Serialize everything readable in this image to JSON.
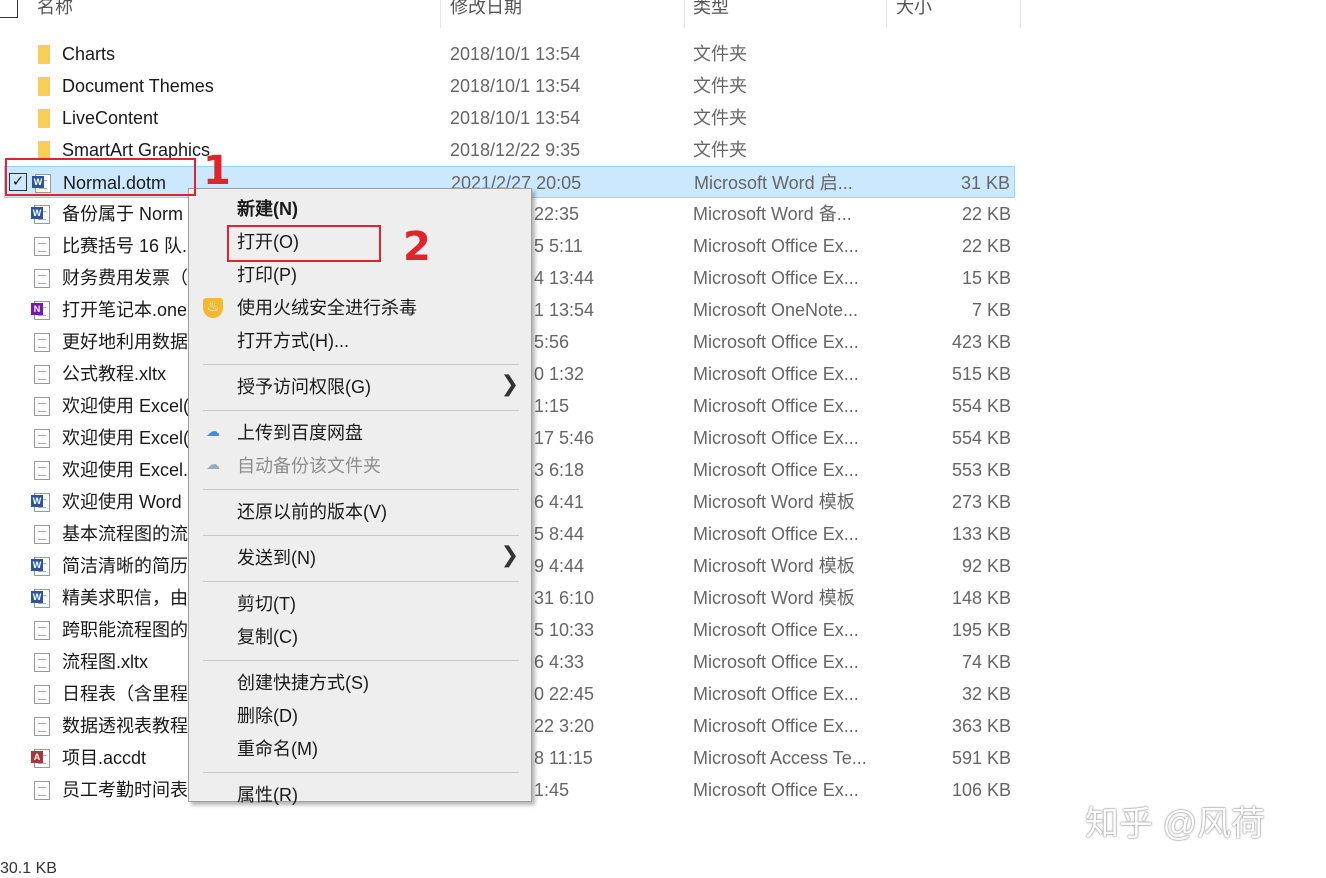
{
  "header": {
    "name": "名称",
    "date": "修改日期",
    "type": "类型",
    "size": "大小"
  },
  "files": [
    {
      "name": "Charts",
      "date": "2018/10/1 13:54",
      "type": "文件夹",
      "size": "",
      "icon": "folder-icon"
    },
    {
      "name": "Document Themes",
      "date": "2018/10/1 13:54",
      "type": "文件夹",
      "size": "",
      "icon": "folder-icon"
    },
    {
      "name": "LiveContent",
      "date": "2018/10/1 13:54",
      "type": "文件夹",
      "size": "",
      "icon": "folder-icon"
    },
    {
      "name": "SmartArt Graphics",
      "date": "2018/12/22 9:35",
      "type": "文件夹",
      "size": "",
      "icon": "folder-icon"
    },
    {
      "name": "Normal.dotm",
      "date": "2021/2/27 20:05",
      "type": "Microsoft Word 启...",
      "size": "31 KB",
      "icon": "word-icon",
      "selected": true
    },
    {
      "name": "备份属于 Norm",
      "date_partial": "22:35",
      "type": "Microsoft Word 备...",
      "size": "22 KB",
      "icon": "word-icon"
    },
    {
      "name": "比赛括号 16 队.",
      "date_partial": "5 5:11",
      "type": "Microsoft Office Ex...",
      "size": "22 KB",
      "icon": "document-icon"
    },
    {
      "name": "财务费用发票（",
      "date_partial": "4 13:44",
      "type": "Microsoft Office Ex...",
      "size": "15 KB",
      "icon": "document-icon"
    },
    {
      "name": "打开笔记本.one",
      "date_partial": "1 13:54",
      "type": "Microsoft OneNote...",
      "size": "7 KB",
      "icon": "onenote-icon"
    },
    {
      "name": "更好地利用数据",
      "date_partial": "5:56",
      "type": "Microsoft Office Ex...",
      "size": "423 KB",
      "icon": "document-icon"
    },
    {
      "name": "公式教程.xltx",
      "date_partial": "0 1:32",
      "type": "Microsoft Office Ex...",
      "size": "515 KB",
      "icon": "document-icon"
    },
    {
      "name": "欢迎使用 Excel(",
      "date_partial": "1:15",
      "type": "Microsoft Office Ex...",
      "size": "554 KB",
      "icon": "document-icon"
    },
    {
      "name": "欢迎使用 Excel(",
      "date_partial": "17 5:46",
      "type": "Microsoft Office Ex...",
      "size": "554 KB",
      "icon": "document-icon"
    },
    {
      "name": "欢迎使用 Excel.",
      "date_partial": "3 6:18",
      "type": "Microsoft Office Ex...",
      "size": "553 KB",
      "icon": "document-icon"
    },
    {
      "name": "欢迎使用 Word",
      "date_partial": "6 4:41",
      "type": "Microsoft Word 模板",
      "size": "273 KB",
      "icon": "word-icon"
    },
    {
      "name": "基本流程图的流",
      "date_partial": "5 8:44",
      "type": "Microsoft Office Ex...",
      "size": "133 KB",
      "icon": "document-icon"
    },
    {
      "name": "简洁清晰的简历",
      "date_partial": "9 4:44",
      "type": "Microsoft Word 模板",
      "size": "92 KB",
      "icon": "word-icon"
    },
    {
      "name": "精美求职信，由",
      "date_partial": "31 6:10",
      "type": "Microsoft Word 模板",
      "size": "148 KB",
      "icon": "word-icon"
    },
    {
      "name": "跨职能流程图的",
      "date_partial": "5 10:33",
      "type": "Microsoft Office Ex...",
      "size": "195 KB",
      "icon": "document-icon"
    },
    {
      "name": "流程图.xltx",
      "date_partial": "6 4:33",
      "type": "Microsoft Office Ex...",
      "size": "74 KB",
      "icon": "document-icon"
    },
    {
      "name": "日程表（含里程",
      "date_partial": "0 22:45",
      "type": "Microsoft Office Ex...",
      "size": "32 KB",
      "icon": "document-icon"
    },
    {
      "name": "数据透视表教程",
      "date_partial": "22 3:20",
      "type": "Microsoft Office Ex...",
      "size": "363 KB",
      "icon": "document-icon"
    },
    {
      "name": "项目.accdt",
      "date_partial": "8 11:15",
      "type": "Microsoft Access Te...",
      "size": "591 KB",
      "icon": "access-icon"
    },
    {
      "name": "员工考勤时间表",
      "date_partial": "1:45",
      "type": "Microsoft Office Ex...",
      "size": "106 KB",
      "icon": "document-icon"
    }
  ],
  "menu": [
    {
      "label": "新建(N)",
      "bold": true
    },
    {
      "label": "打开(O)"
    },
    {
      "label": "打印(P)"
    },
    {
      "label": "使用火绒安全进行杀毒",
      "icon": "huorong-shield-icon"
    },
    {
      "label": "打开方式(H)..."
    },
    {
      "sep": true
    },
    {
      "label": "授予访问权限(G)",
      "submenu": true
    },
    {
      "sep": true
    },
    {
      "label": "上传到百度网盘",
      "icon": "baidu-netdisk-icon"
    },
    {
      "label": "自动备份该文件夹",
      "icon": "baidu-netdisk-icon",
      "disabled": true
    },
    {
      "sep": true
    },
    {
      "label": "还原以前的版本(V)"
    },
    {
      "sep": true
    },
    {
      "label": "发送到(N)",
      "submenu": true
    },
    {
      "sep": true
    },
    {
      "label": "剪切(T)"
    },
    {
      "label": "复制(C)"
    },
    {
      "sep": true
    },
    {
      "label": "创建快捷方式(S)"
    },
    {
      "label": "删除(D)"
    },
    {
      "label": "重命名(M)"
    },
    {
      "sep": true
    },
    {
      "label": "属性(R)"
    }
  ],
  "annotations": {
    "step1": "1",
    "step2": "2",
    "color": "#e0242e"
  },
  "status": {
    "size": "30.1 KB"
  },
  "watermark": "知乎 @风荷",
  "colors": {
    "selection": "#cce8ff",
    "selection_border": "#99d1ff",
    "menu_bg": "#eeeeee"
  }
}
